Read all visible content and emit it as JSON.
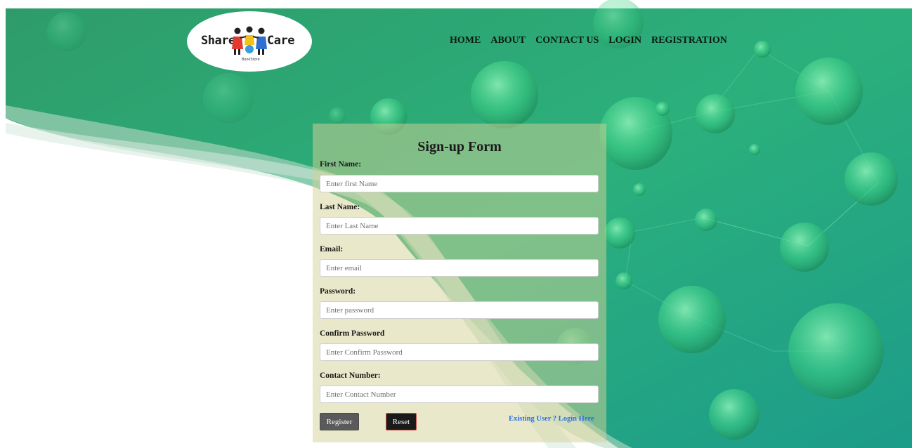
{
  "brand": {
    "left_word": "Share",
    "right_word": "Care",
    "sub": "BookStore"
  },
  "nav": {
    "items": [
      "HOME",
      "ABOUT",
      "CONTACT US",
      "LOGIN",
      "REGISTRATION"
    ]
  },
  "form": {
    "title": "Sign-up Form",
    "first_name_label": "First Name:",
    "first_name_placeholder": "Enter first Name",
    "last_name_label": "Last Name:",
    "last_name_placeholder": "Enter Last Name",
    "email_label": "Email:",
    "email_placeholder": "Enter email",
    "password_label": "Password:",
    "password_placeholder": "Enter password",
    "confirm_label": "Confirm Password",
    "confirm_placeholder": "Enter Confirm Password",
    "contact_label": "Contact Number:",
    "contact_placeholder": "Enter Contact Number",
    "register_label": "Register",
    "reset_label": "Reset",
    "login_link": "Existing User ? Login Here"
  },
  "colors": {
    "bg_green": "#23a87a",
    "panel": "#d6d296",
    "link": "#2a6fe0"
  }
}
